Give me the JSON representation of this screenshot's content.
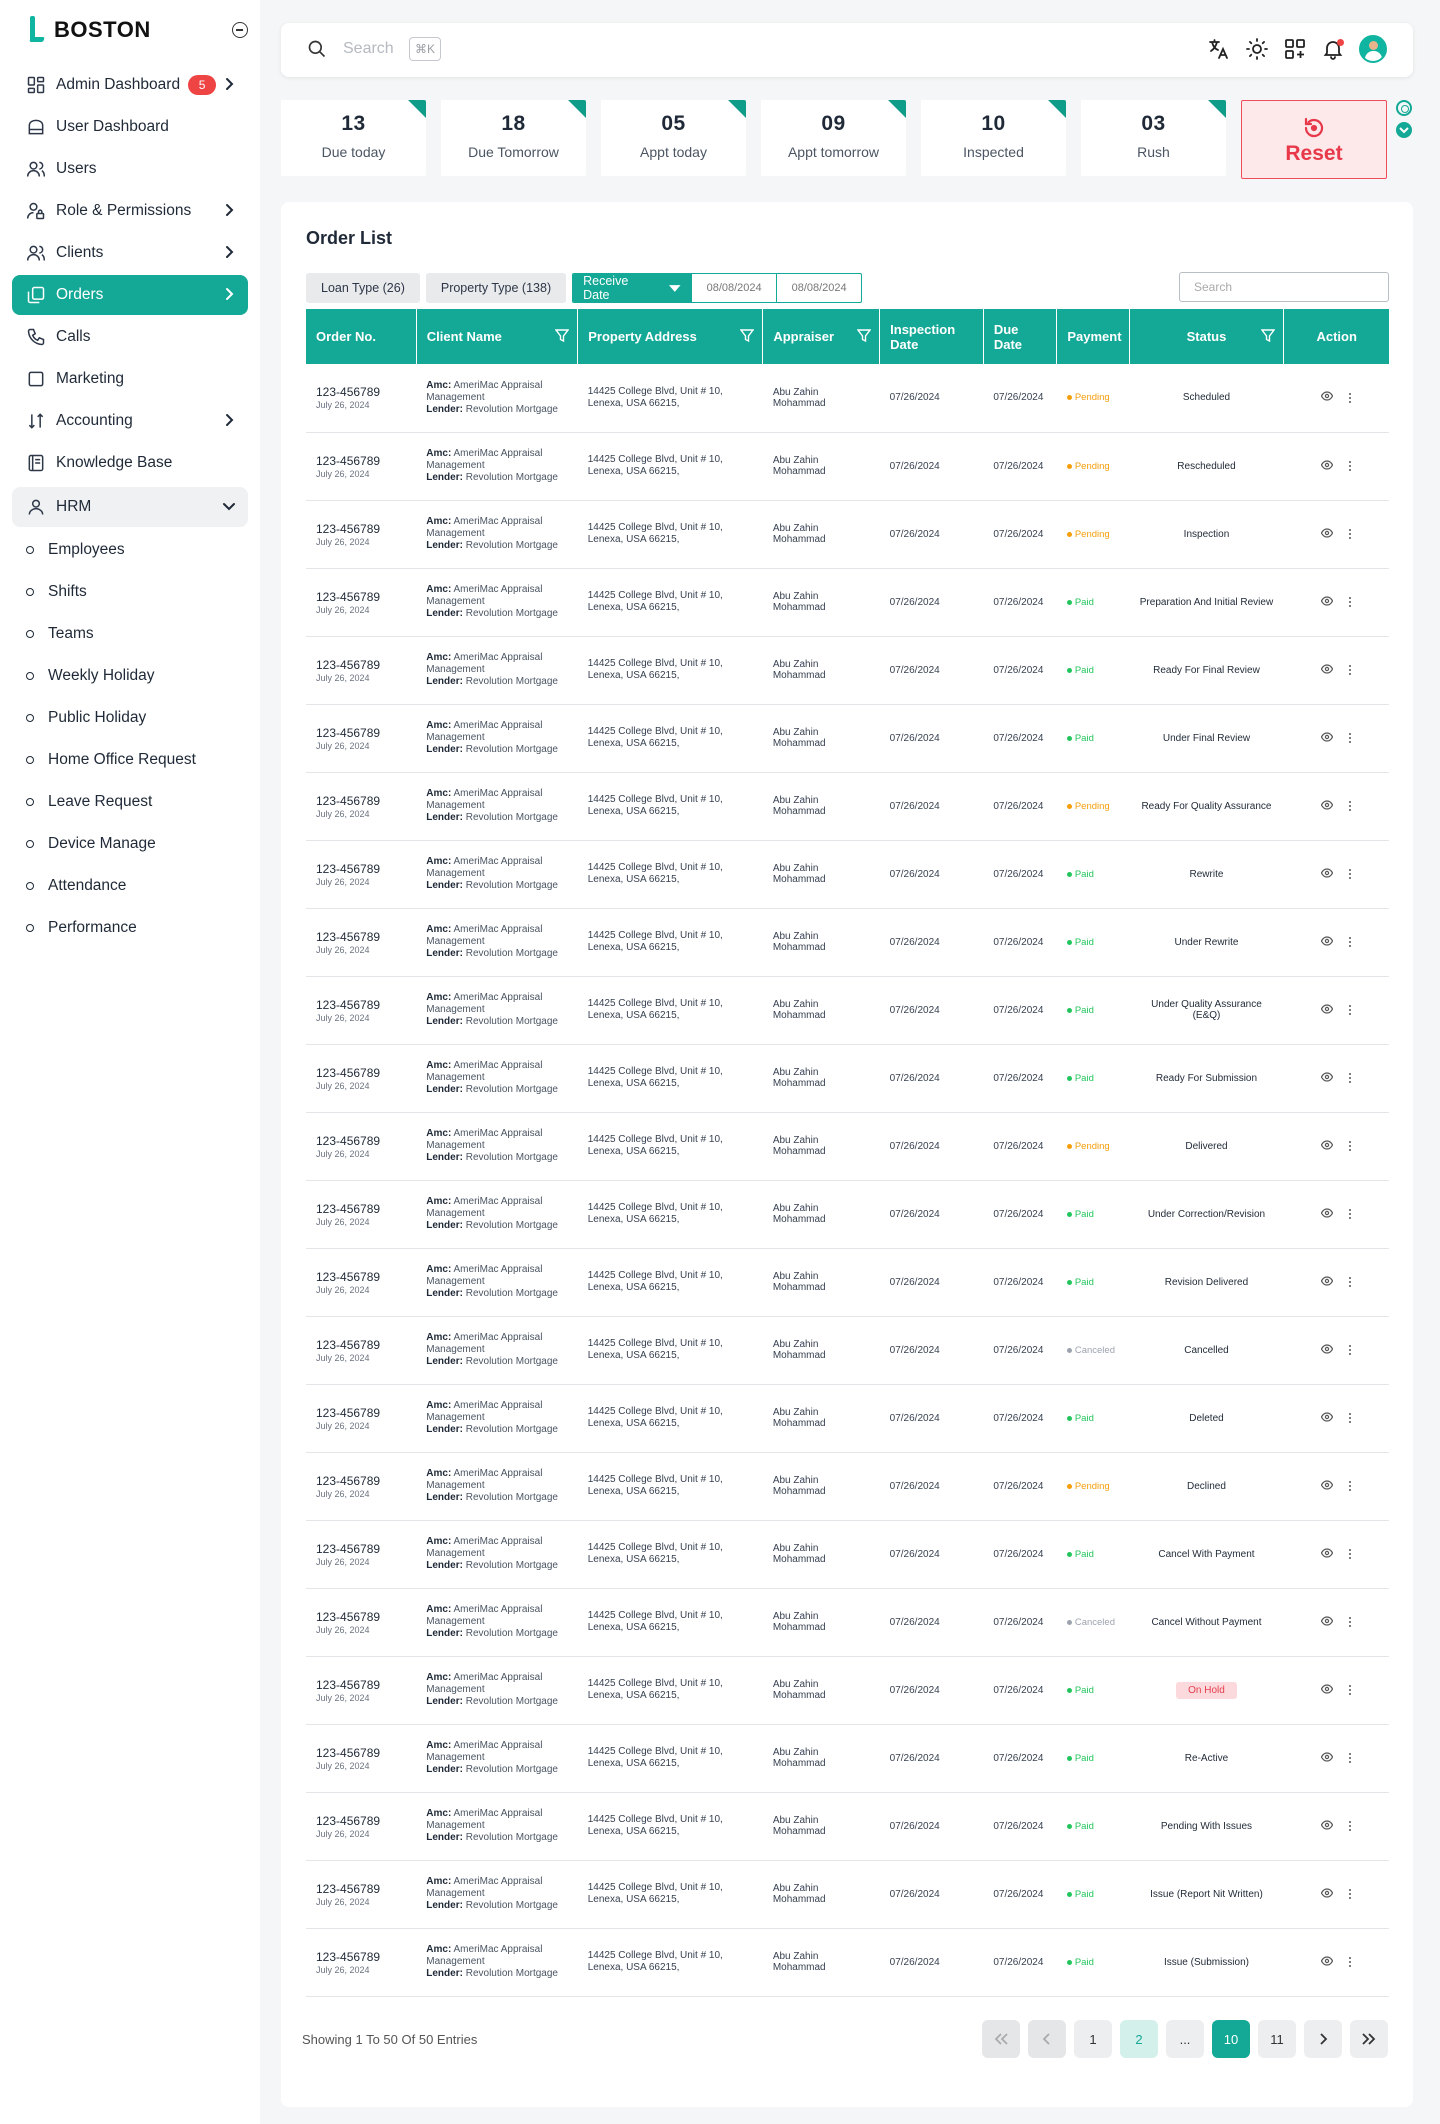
{
  "brand": {
    "name": "BOSTON"
  },
  "nav": [
    {
      "label": "Admin Dashboard",
      "icon": "dashboard-grid-icon",
      "badge": "5",
      "chevron": true
    },
    {
      "label": "User Dashboard",
      "icon": "home-icon"
    },
    {
      "label": "Users",
      "icon": "users-icon"
    },
    {
      "label": "Role & Permissions",
      "icon": "user-lock-icon",
      "chevron": true
    },
    {
      "label": "Clients",
      "icon": "clients-icon",
      "chevron": true
    },
    {
      "label": "Orders",
      "icon": "orders-copy-icon",
      "chevron": true,
      "active": true
    },
    {
      "label": "Calls",
      "icon": "phone-icon"
    },
    {
      "label": "Marketing",
      "icon": "square-icon"
    },
    {
      "label": "Accounting",
      "icon": "sort-arrows-icon",
      "chevron": true
    },
    {
      "label": "Knowledge Base",
      "icon": "book-icon"
    }
  ],
  "hrm": {
    "label": "HRM",
    "items": [
      "Employees",
      "Shifts",
      "Teams",
      "Weekly Holiday",
      "Public Holiday",
      "Home Office Request",
      "Leave Request",
      "Device Manage",
      "Attendance",
      "Performance"
    ]
  },
  "topbar": {
    "search_placeholder": "Search",
    "shortcut": "⌘K"
  },
  "stats": [
    {
      "num": "13",
      "label": "Due today"
    },
    {
      "num": "18",
      "label": "Due Tomorrow"
    },
    {
      "num": "05",
      "label": "Appt today"
    },
    {
      "num": "09",
      "label": "Appt tomorrow"
    },
    {
      "num": "10",
      "label": "Inspected"
    },
    {
      "num": "03",
      "label": "Rush"
    }
  ],
  "reset_label": "Reset",
  "order_list": {
    "title": "Order List",
    "filters": {
      "loan_type": "Loan Type (26)",
      "property_type": "Property Type (138)",
      "date_select": "Receive Date",
      "date_from": "08/08/2024",
      "date_to": "08/08/2024"
    },
    "search_placeholder": "Search",
    "columns": [
      "Order No.",
      "Client Name",
      "Property Address",
      "Appraiser",
      "Inspection Date",
      "Due Date",
      "Payment",
      "Status",
      "Action"
    ],
    "row_common": {
      "order_no": "123-456789",
      "order_date": "July 26, 2024",
      "amc_label": "Amc:",
      "amc": "AmeriMac Appraisal Management",
      "lender_label": "Lender:",
      "lender": "Revolution Mortgage",
      "address": "14425 College Blvd, Unit # 10, Lenexa, USA 66215,",
      "appraiser": "Abu Zahin Mohammad",
      "inspection_date": "07/26/2024",
      "due_date": "07/26/2024"
    },
    "rows": [
      {
        "payment": "Pending",
        "status": "Scheduled"
      },
      {
        "payment": "Pending",
        "status": "Rescheduled"
      },
      {
        "payment": "Pending",
        "status": "Inspection"
      },
      {
        "payment": "Paid",
        "status": "Preparation And Initial Review"
      },
      {
        "payment": "Paid",
        "status": "Ready For Final Review"
      },
      {
        "payment": "Paid",
        "status": "Under Final Review"
      },
      {
        "payment": "Pending",
        "status": "Ready For Quality Assurance"
      },
      {
        "payment": "Paid",
        "status": "Rewrite"
      },
      {
        "payment": "Paid",
        "status": "Under Rewrite"
      },
      {
        "payment": "Paid",
        "status": "Under Quality Assurance (E&Q)"
      },
      {
        "payment": "Paid",
        "status": "Ready For Submission"
      },
      {
        "payment": "Pending",
        "status": "Delivered"
      },
      {
        "payment": "Paid",
        "status": "Under Correction/Revision"
      },
      {
        "payment": "Paid",
        "status": "Revision Delivered"
      },
      {
        "payment": "Canceled",
        "status": "Cancelled"
      },
      {
        "payment": "Paid",
        "status": "Deleted"
      },
      {
        "payment": "Pending",
        "status": "Declined"
      },
      {
        "payment": "Paid",
        "status": "Cancel With Payment"
      },
      {
        "payment": "Canceled",
        "status": "Cancel Without Payment"
      },
      {
        "payment": "Paid",
        "status": "On Hold",
        "highlight": true
      },
      {
        "payment": "Paid",
        "status": "Re-Active"
      },
      {
        "payment": "Paid",
        "status": "Pending With Issues"
      },
      {
        "payment": "Paid",
        "status": "Issue (Report Nit Written)"
      },
      {
        "payment": "Paid",
        "status": "Issue (Submission)"
      }
    ],
    "payment_colors": {
      "Pending": "#f59e0b",
      "Paid": "#22c55e",
      "Canceled": "#9ca3af"
    }
  },
  "footer": {
    "showing": "Showing 1 To 50 Of 50 Entries",
    "pages": [
      "1",
      "2",
      "...",
      "10",
      "11"
    ]
  },
  "colors": {
    "accent": "#14a896",
    "danger": "#ef4d5a"
  }
}
